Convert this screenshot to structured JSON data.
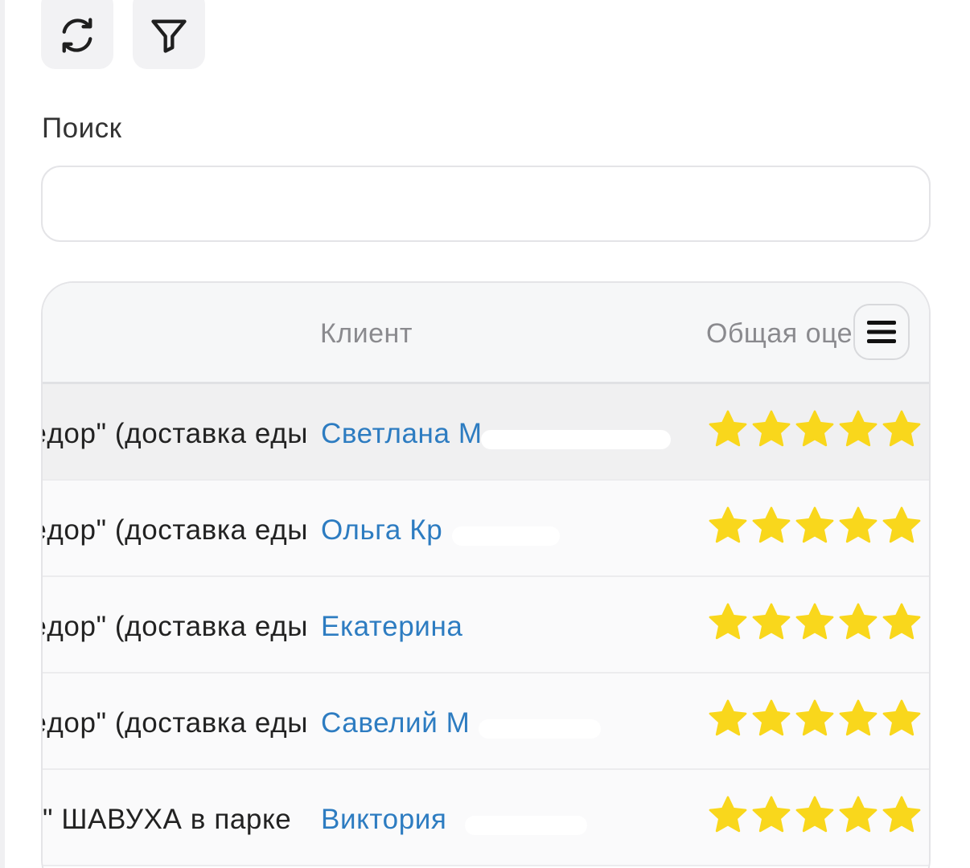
{
  "toolbar": {
    "refresh_icon": "refresh-icon",
    "filter_icon": "filter-icon"
  },
  "search": {
    "label": "Поиск",
    "value": "",
    "placeholder": ""
  },
  "table": {
    "columns": {
      "client": "Клиент",
      "rating": "Общая оценка"
    },
    "menu_icon": "menu-icon",
    "rows": [
      {
        "point": "\"Дядя Фёдор\" (доставка еды",
        "client": "Светлана М",
        "rating": 5
      },
      {
        "point": "\"Дядя Фёдор\" (доставка еды",
        "client": "Ольга Кр",
        "rating": 5
      },
      {
        "point": "\"Дядя Фёдор\" (доставка еды",
        "client": "Екатерина",
        "rating": 5
      },
      {
        "point": "\"Дядя Фёдор\" (доставка еды",
        "client": "Савелий М",
        "rating": 5
      },
      {
        "point": "\" ШАВУХА в парке",
        "client": "Виктория",
        "rating": 5
      }
    ]
  },
  "colors": {
    "link": "#2d7cc1",
    "star": "#f9d71c",
    "header_text": "#8a8a8e"
  }
}
